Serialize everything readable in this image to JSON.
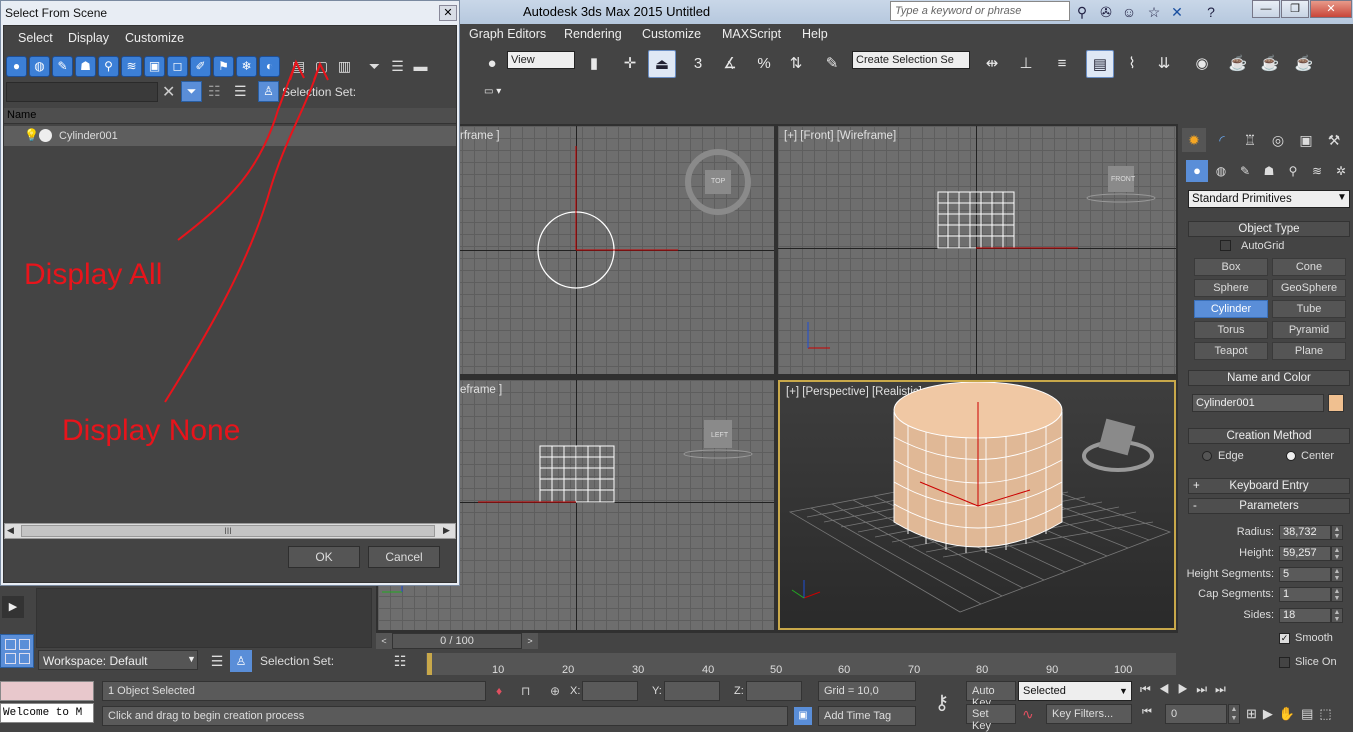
{
  "app": {
    "title": "Autodesk 3ds Max  2015    Untitled",
    "search_placeholder": "Type a keyword or phrase"
  },
  "menubar": [
    "Graph Editors",
    "Rendering",
    "Customize",
    "MAXScript",
    "Help"
  ],
  "toolbar": {
    "view_select": "View",
    "selection_set_select": "Create Selection Se",
    "snap_labels": [
      "3",
      "%"
    ]
  },
  "viewports": [
    {
      "label": "rframe ]",
      "id": "top"
    },
    {
      "label": "[+] [Front] [Wireframe]",
      "id": "front",
      "viewcube": "FRONT"
    },
    {
      "label": "eframe ]",
      "id": "left",
      "viewcube": "LEFT"
    },
    {
      "label": "[+] [Perspective] [Realistic]",
      "id": "perspective"
    }
  ],
  "viewcube_top": "TOP",
  "command_panel": {
    "dropdown": "Standard Primitives",
    "object_type_title": "Object Type",
    "autogrid": "AutoGrid",
    "buttons": [
      "Box",
      "Cone",
      "Sphere",
      "GeoSphere",
      "Cylinder",
      "Tube",
      "Torus",
      "Pyramid",
      "Teapot",
      "Plane"
    ],
    "active_button": "Cylinder",
    "name_color_title": "Name and Color",
    "object_name": "Cylinder001",
    "object_color": "#f0c090",
    "creation_method_title": "Creation Method",
    "creation_edge": "Edge",
    "creation_center": "Center",
    "keyboard_entry_title": "Keyboard Entry",
    "parameters_title": "Parameters",
    "params": [
      {
        "label": "Radius:",
        "value": "38,732"
      },
      {
        "label": "Height:",
        "value": "59,257"
      },
      {
        "label": "Height Segments:",
        "value": "5"
      },
      {
        "label": "Cap Segments:",
        "value": "1"
      },
      {
        "label": "Sides:",
        "value": "18"
      }
    ],
    "smooth": "Smooth",
    "slice_on": "Slice On"
  },
  "timeline": {
    "frame_display": "0 / 100",
    "ticks": [
      "10",
      "20",
      "30",
      "40",
      "50",
      "60",
      "70",
      "80",
      "90",
      "100"
    ]
  },
  "status": {
    "selected": "1 Object Selected",
    "prompt": "Click and drag to begin creation process",
    "x_label": "X:",
    "y_label": "Y:",
    "z_label": "Z:",
    "grid": "Grid = 10,0",
    "add_time_tag": "Add Time Tag",
    "auto_key": "Auto Key",
    "set_key": "Set Key",
    "key_mode": "Selected",
    "key_filters": "Key Filters...",
    "frame_field": "0",
    "maxscript": "Welcome to M"
  },
  "workspace": {
    "label": "Workspace: Default",
    "selection_set": "Selection Set:"
  },
  "dialog": {
    "title": "Select From Scene",
    "menus": [
      "Select",
      "Display",
      "Customize"
    ],
    "selection_set": "Selection Set:",
    "column_name": "Name",
    "items": [
      {
        "name": "Cylinder001"
      }
    ],
    "ok": "OK",
    "cancel": "Cancel",
    "scroll_thumb": "III"
  },
  "annotations": {
    "display_all": "Display All",
    "display_none": "Display None"
  }
}
